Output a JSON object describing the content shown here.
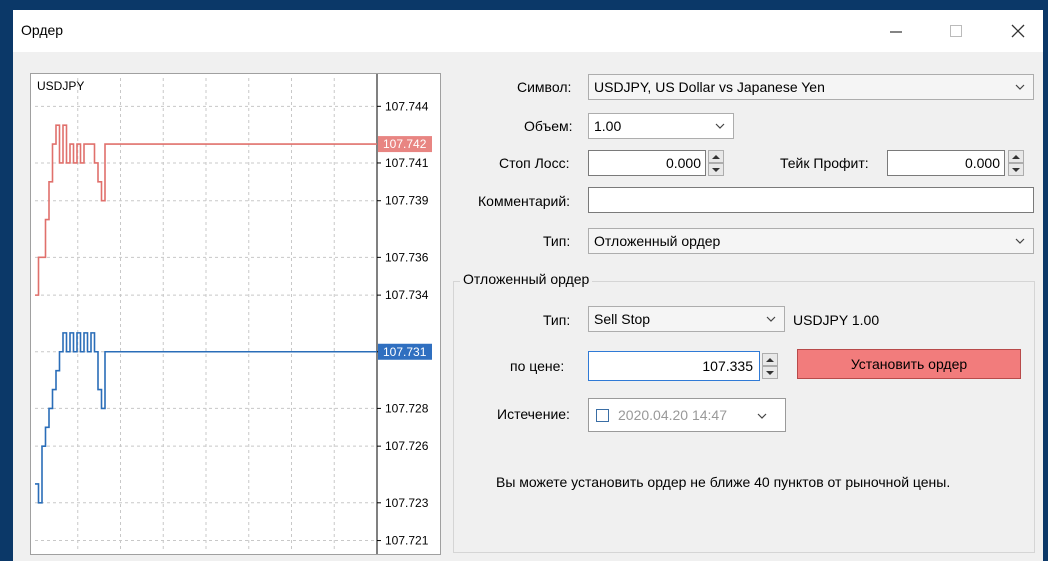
{
  "window": {
    "title": "Ордер"
  },
  "chart": {
    "symbol": "USDJPY",
    "price_labels": [
      "107.744",
      "107.741",
      "107.739",
      "107.736",
      "107.734",
      "107.731",
      "107.728",
      "107.726",
      "107.723",
      "107.721"
    ],
    "ask_label": "107.742",
    "bid_label": "107.731",
    "colors": {
      "ask": "#e0706c",
      "bid": "#2a6db8",
      "ask_tag": "#e88582",
      "bid_tag": "#2f6fc0"
    }
  },
  "chart_data": {
    "type": "line",
    "title": "USDJPY",
    "y_ticks": [
      107.744,
      107.741,
      107.739,
      107.736,
      107.734,
      107.731,
      107.728,
      107.726,
      107.723,
      107.721
    ],
    "ylim": [
      107.7205,
      107.7455
    ],
    "grid": true,
    "series": [
      {
        "values": [
          107.734,
          107.736,
          107.736,
          107.738,
          107.74,
          107.742,
          107.743,
          107.741,
          107.743,
          107.741,
          107.742,
          107.741,
          107.742,
          107.741,
          107.742,
          107.742,
          107.742,
          107.741,
          107.74,
          107.739,
          107.742,
          107.742,
          107.742,
          107.742,
          107.742,
          107.742,
          107.742,
          107.742,
          107.742,
          107.742,
          107.742,
          107.742,
          107.742,
          107.742,
          107.742
        ]
      },
      {
        "values": [
          107.724,
          107.723,
          107.726,
          107.727,
          107.728,
          107.729,
          107.73,
          107.731,
          107.732,
          107.731,
          107.732,
          107.731,
          107.732,
          107.731,
          107.732,
          107.731,
          107.732,
          107.731,
          107.729,
          107.728,
          107.731,
          107.731,
          107.731,
          107.731,
          107.731,
          107.731,
          107.731,
          107.731,
          107.731,
          107.731,
          107.731,
          107.731,
          107.731,
          107.731,
          107.731
        ]
      }
    ]
  },
  "form": {
    "symbol_label": "Символ:",
    "symbol_value": "USDJPY, US Dollar vs Japanese Yen",
    "volume_label": "Объем:",
    "volume_value": "1.00",
    "stoploss_label": "Стоп Лосс:",
    "stoploss_value": "0.000",
    "takeprofit_label": "Тейк Профит:",
    "takeprofit_value": "0.000",
    "comment_label": "Комментарий:",
    "comment_value": "",
    "type_label": "Тип:",
    "type_value": "Отложенный ордер"
  },
  "pending": {
    "group_title": "Отложенный ордер",
    "type_label": "Тип:",
    "type_value": "Sell Stop",
    "symbol_volume": "USDJPY 1.00",
    "price_label": "по цене:",
    "price_value": "107.335",
    "set_button": "Установить ордер",
    "expiry_label": "Истечение:",
    "expiry_value": "2020.04.20 14:47",
    "note": "Вы можете установить ордер не ближе 40 пунктов от рыночной цены."
  }
}
